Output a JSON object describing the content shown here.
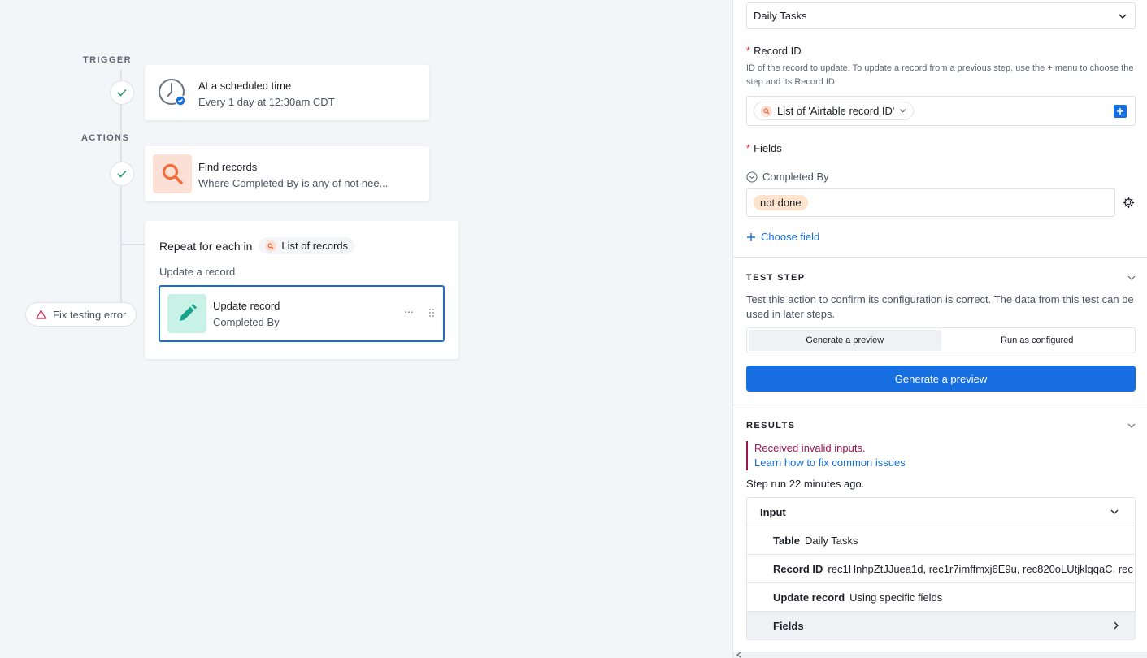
{
  "canvas": {
    "trigger_label": "TRIGGER",
    "actions_label": "ACTIONS",
    "trigger_card": {
      "title": "At a scheduled time",
      "subtitle": "Every 1 day at 12:30am CDT"
    },
    "find_card": {
      "title": "Find records",
      "subtitle": "Where Completed By is any of not nee..."
    },
    "repeat_card": {
      "title": "Repeat for each in",
      "chip": "List of records",
      "sublabel": "Update a record",
      "inner": {
        "title": "Update record",
        "subtitle": "Completed By",
        "more": "···"
      }
    },
    "fix_error_label": "Fix testing error"
  },
  "panel": {
    "table_select_value": "Daily Tasks",
    "record_id": {
      "label": "Record ID",
      "help": "ID of the record to update. To update a record from a previous step, use the + menu to choose the step and its Record ID.",
      "token": "List of 'Airtable record ID'"
    },
    "fields": {
      "label": "Fields",
      "field_name": "Completed By",
      "value_tag": "not done",
      "choose_field": "Choose field"
    },
    "test_step": {
      "heading": "TEST STEP",
      "description": "Test this action to confirm its configuration is correct. The data from this test can be used in later steps.",
      "tabs": [
        "Generate a preview",
        "Run as configured"
      ],
      "button": "Generate a preview"
    },
    "results": {
      "heading": "RESULTS",
      "error": "Received invalid inputs.",
      "error_link": "Learn how to fix common issues",
      "step_run": "Step run 22 minutes ago.",
      "input_header": "Input",
      "rows": [
        {
          "key": "Table",
          "value": "Daily Tasks"
        },
        {
          "key": "Record ID",
          "value": "rec1HnhpZtJJuea1d, rec1r7imffmxj6E9u, rec820oLUtjklqqaC, rec"
        },
        {
          "key": "Update record",
          "value": "Using specific fields"
        },
        {
          "key": "Fields",
          "value": ""
        }
      ]
    }
  },
  "colors": {
    "primary": "#166ee1",
    "error": "#a0154f",
    "find_tile": "#fde0d5",
    "update_tile": "#c8f2e6",
    "tag_bg": "#fde2cc"
  }
}
